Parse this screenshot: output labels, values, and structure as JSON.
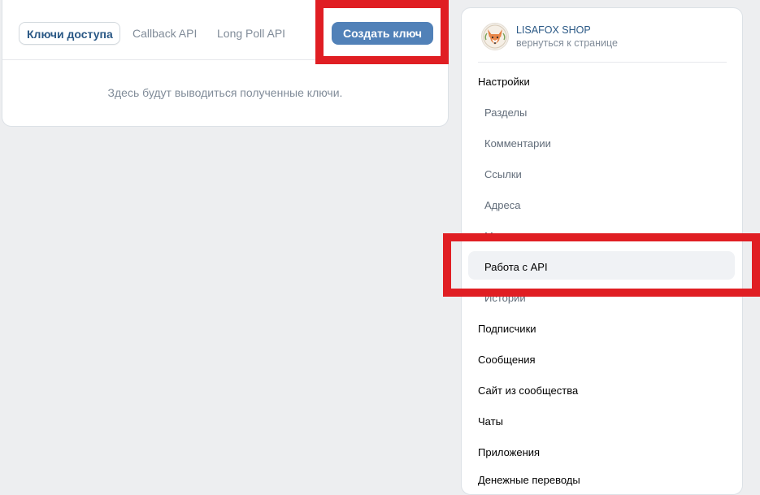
{
  "tabs": [
    {
      "label": "Ключи доступа",
      "active": true
    },
    {
      "label": "Callback API",
      "active": false
    },
    {
      "label": "Long Poll API",
      "active": false
    }
  ],
  "create_button_label": "Создать ключ",
  "empty_message": "Здесь будут выводиться полученные ключи.",
  "community": {
    "name": "LISAFOX SHOP",
    "back_link": "вернуться к странице",
    "avatar_icon": "fox-logo-icon"
  },
  "menu": {
    "settings": "Настройки",
    "settings_subitems": [
      {
        "label": "Разделы"
      },
      {
        "label": "Комментарии"
      },
      {
        "label": "Ссылки"
      },
      {
        "label": "Адреса"
      },
      {
        "label": "Меню"
      },
      {
        "label": "Работа с API",
        "active": true
      },
      {
        "label": "Истории"
      }
    ],
    "items": [
      {
        "label": "Подписчики"
      },
      {
        "label": "Сообщения"
      },
      {
        "label": "Сайт из сообщества"
      },
      {
        "label": "Чаты"
      },
      {
        "label": "Приложения"
      },
      {
        "label": "Денежные переводы"
      }
    ]
  },
  "colors": {
    "accent": "#5181b8",
    "link": "#2a5885",
    "highlight": "#e01e23",
    "background": "#edeef0"
  }
}
